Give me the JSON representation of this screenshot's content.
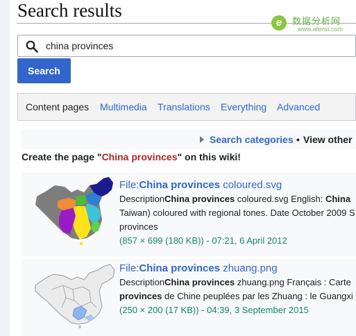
{
  "page": {
    "title": "Search results",
    "logo_text": "数据分析网",
    "logo_sub": "www.afenxi.com",
    "logo_letter": "e"
  },
  "search": {
    "value": "china provinces",
    "button": "Search"
  },
  "tabs": [
    {
      "label": "Content pages",
      "active": true
    },
    {
      "label": "Multimedia"
    },
    {
      "label": "Translations"
    },
    {
      "label": "Everything"
    },
    {
      "label": "Advanced"
    }
  ],
  "categories": {
    "link": "Search categories",
    "bullet": "•",
    "view": "View other"
  },
  "create": {
    "prefix": "Create the page \"",
    "page": "China provinces",
    "suffix": "\" on this wiki!"
  },
  "results": [
    {
      "title_prefix": "File:",
      "title_bold": "China provinces",
      "title_rest": " coloured.svg",
      "desc1_prefix": "Description",
      "desc1_bold": "China provinces",
      "desc1_rest": " coloured.svg English: ",
      "desc1_end": "China",
      "desc2": "Taiwan) coloured with regional tones. Date October 2009 S",
      "desc3": "provinces",
      "meta": "(857 × 699 (180 KB)) - 07:21, 6 April 2012"
    },
    {
      "title_prefix": "File:",
      "title_bold": "China provinces",
      "title_rest": " zhuang.png",
      "desc1_prefix": "Description",
      "desc1_bold": "China provinces",
      "desc1_rest": " zhuang.png Français : Carte",
      "desc2_bold": "provinces",
      "desc2_rest": " de Chine peuplées par les Zhuang : le Guangxi",
      "meta": "(250 × 200 (17 KB)) - 04:39, 3 September 2015"
    }
  ],
  "colors": {
    "link": "#3366cc",
    "button": "#3366cc",
    "red_link": "#b32424",
    "meta_green": "#14866d"
  }
}
